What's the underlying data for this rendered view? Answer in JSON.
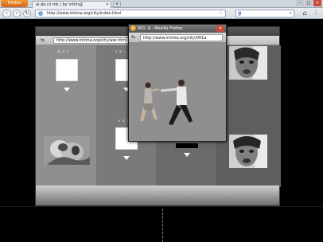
{
  "browser": {
    "app_button": "Firefox",
    "tab_title": "ai.de.cz.mk | by intim@",
    "new_tab": "+",
    "url": "http://www.intima.org/city/index.html",
    "search_icon": "search-icon",
    "home_icon": "home-icon"
  },
  "back_window": {
    "url": "http://www.intima.org/city/war.html",
    "label_col1": "b o t",
    "label_col2_top": "s k ... p",
    "label_col2_mid": "s k p",
    "footer_glyphs": [
      "⌐",
      "⌐",
      "=",
      "¬",
      "⌐"
    ]
  },
  "front_window": {
    "title": "001: A - Mozilla Firefox",
    "url": "http://www.intima.org/city/001a"
  },
  "colors": {
    "firefox_orange": "#e0651a",
    "close_red": "#c64a3a"
  }
}
